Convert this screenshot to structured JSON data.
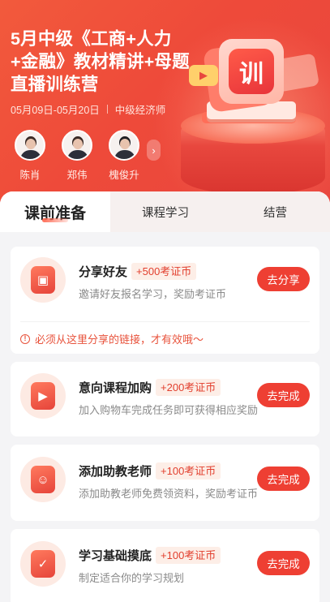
{
  "hero": {
    "title": "5月中级《工商+人力+金融》教材精讲+母题直播训练营",
    "date_range": "05月09日-05月20日",
    "category": "中级经济师",
    "teachers": [
      {
        "name": "陈肖"
      },
      {
        "name": "郑伟"
      },
      {
        "name": "槐俊升"
      }
    ],
    "badge_char": "训"
  },
  "tabs": [
    {
      "label": "课前准备",
      "active": true
    },
    {
      "label": "课程学习",
      "active": false
    },
    {
      "label": "结营",
      "active": false
    }
  ],
  "tasks": [
    {
      "title": "分享好友",
      "reward": "+500考证币",
      "desc": "邀请好友报名学习，奖励考证币",
      "button": "去分享",
      "icon": "share-card-icon"
    },
    {
      "title": "意向课程加购",
      "reward": "+200考证币",
      "desc": "加入购物车完成任务即可获得相应奖励",
      "button": "去完成",
      "icon": "cart-icon"
    },
    {
      "title": "添加助教老师",
      "reward": "+100考证币",
      "desc": "添加助教老师免费领资料，奖励考证币",
      "button": "去完成",
      "icon": "contact-card-icon"
    },
    {
      "title": "学习基础摸底",
      "reward": "+100考证币",
      "desc": "制定适合你的学习规划",
      "button": "去完成",
      "icon": "checklist-icon"
    }
  ],
  "notice": "必须从这里分享的链接，才有效哦～",
  "colors": {
    "primary": "#ee3f33",
    "hero": "#ee4a3a",
    "reward_bg": "#fdeee7"
  }
}
